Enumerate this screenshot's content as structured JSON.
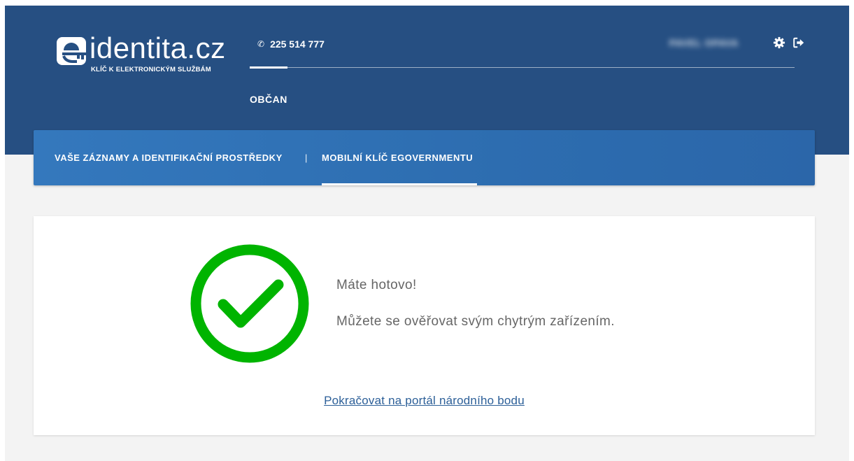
{
  "header": {
    "logo_text": "identita.cz",
    "logo_tagline": "KLÍČ K ELEKTRONICKÝM SLUŽBÁM",
    "phone": "225 514 777",
    "nav_item": "OBČAN",
    "user_name": "PAVEL OPAVA",
    "icons": {
      "phone": "phone-icon",
      "settings": "gear-icon",
      "logout": "logout-icon"
    }
  },
  "subnav": {
    "items": [
      {
        "label": "VAŠE ZÁZNAMY A IDENTIFIKAČNÍ PROSTŘEDKY"
      },
      {
        "label": "MOBILNÍ KLÍČ EGOVERNMENTU"
      }
    ],
    "separator": "|"
  },
  "main": {
    "title": "Máte hotovo!",
    "message": "Můžete se ověřovat svým chytrým zařízením.",
    "continue_link": "Pokračovat na portál národního bodu"
  },
  "colors": {
    "header_bg": "#264f82",
    "subnav_bg": "#3478bd",
    "success_green": "#00b400",
    "link": "#2c5f98"
  }
}
